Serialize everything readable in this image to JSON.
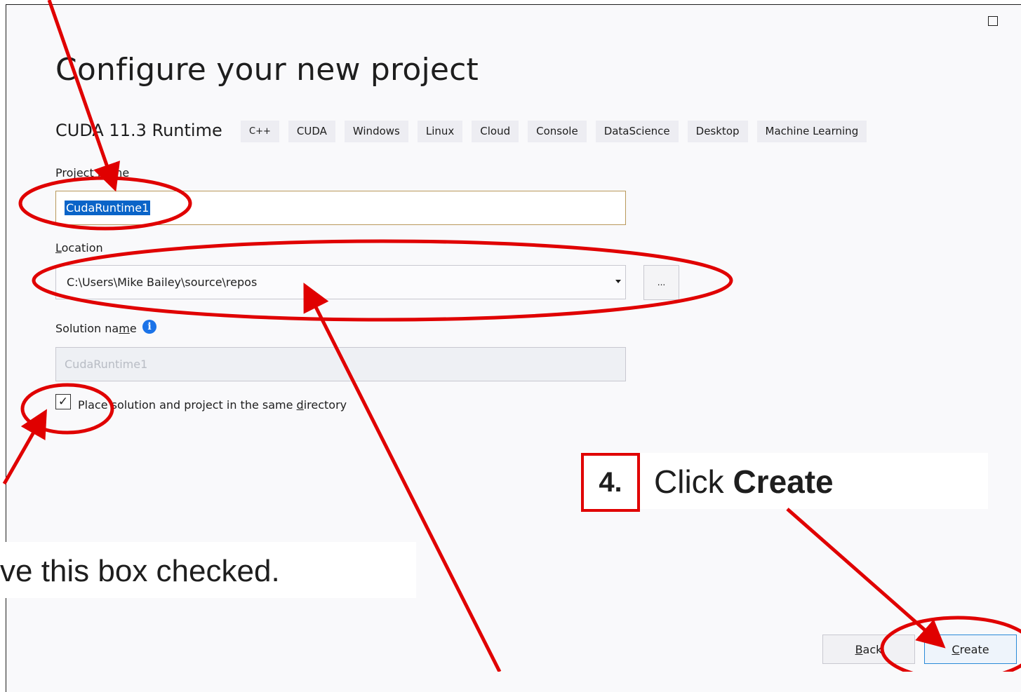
{
  "dialog": {
    "title": "Configure your new project",
    "template_name": "CUDA 11.3 Runtime",
    "tags": [
      "C++",
      "CUDA",
      "Windows",
      "Linux",
      "Cloud",
      "Console",
      "DataScience",
      "Desktop",
      "Machine Learning"
    ]
  },
  "project_name": {
    "label_prefix": "Project ",
    "label_accel": "n",
    "label_suffix": "ame",
    "value": "CudaRuntime1"
  },
  "location": {
    "label_accel": "L",
    "label_suffix": "ocation",
    "value": "C:\\Users\\Mike Bailey\\source\\repos",
    "browse_label": "..."
  },
  "solution": {
    "label_prefix": "Solution na",
    "label_accel": "m",
    "label_suffix": "e",
    "value": "CudaRuntime1",
    "info_icon": "i"
  },
  "same_directory": {
    "checked_glyph": "✓",
    "label_prefix": "Place solution and project in the same ",
    "label_accel": "d",
    "label_suffix": "irectory"
  },
  "buttons": {
    "back_accel": "B",
    "back_suffix": "ack",
    "create_accel": "C",
    "create_suffix": "reate"
  },
  "callouts": {
    "step_number": "4.",
    "step_text_prefix": "Click ",
    "step_text_bold": "Create",
    "checkbox_note": "ve this box checked."
  },
  "colors": {
    "annotation": "#e00000",
    "selection": "#0a64c8",
    "info": "#1b73e8"
  }
}
